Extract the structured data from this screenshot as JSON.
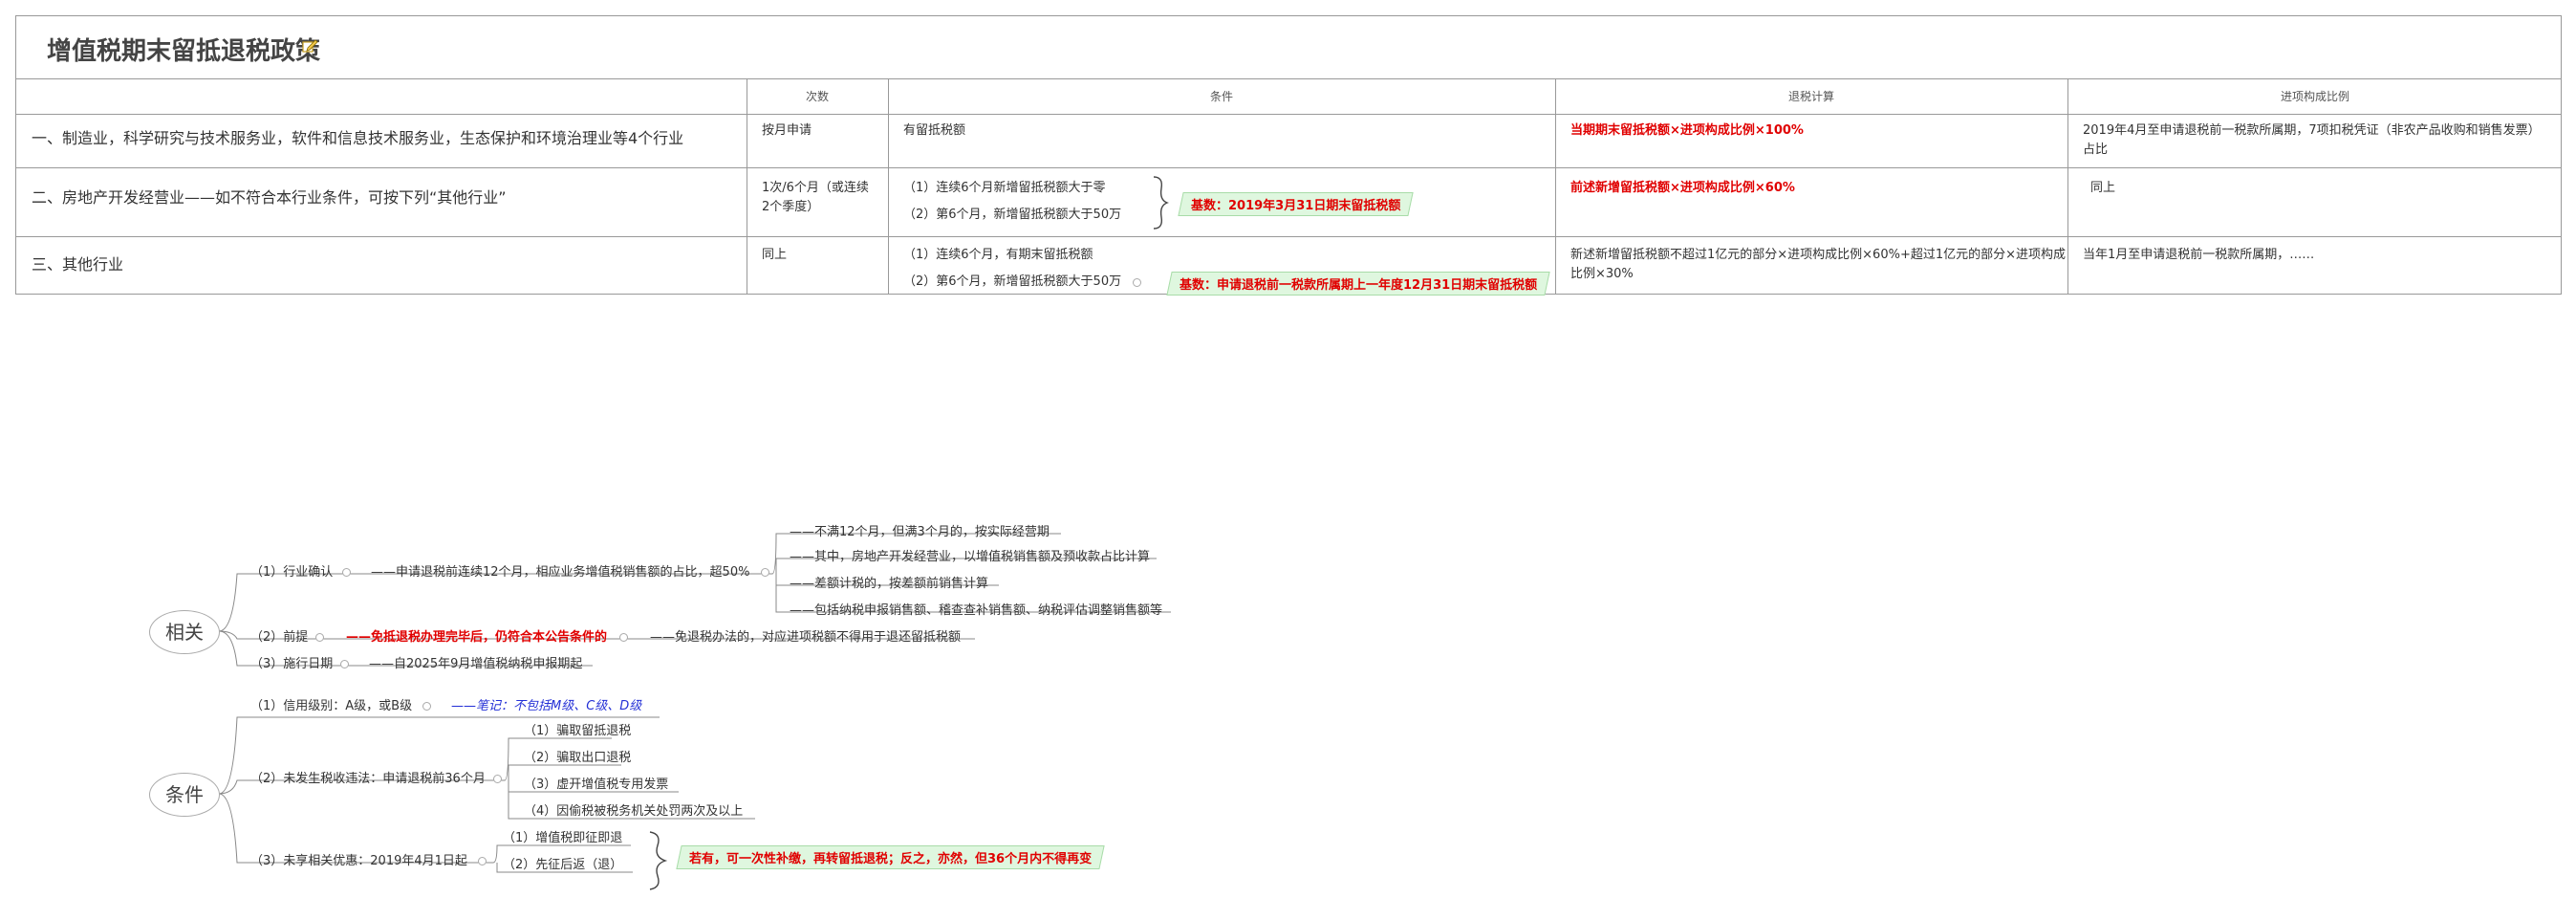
{
  "title": "增值税期末留抵退税政策",
  "table": {
    "headers": [
      "次数",
      "条件",
      "退税计算",
      "进项构成比例"
    ],
    "rows": [
      {
        "industry": "一、制造业，科学研究与技术服务业，软件和信息技术服务业，生态保护和环境治理业等4个行业",
        "frequency": "按月申请",
        "conditions": [
          "有留抵税额"
        ],
        "calc": "当期期末留抵税额×进项构成比例×100%",
        "ratio": "2019年4月至申请退税前一税款所属期，7项扣税凭证（非农产品收购和销售发票）占比"
      },
      {
        "industry": "二、房地产开发经营业——如不符合本行业条件，可按下列“其他行业”",
        "frequency": "1次/6个月（或连续2个季度）",
        "conditions": [
          "（1）连续6个月新增留抵税额大于零",
          "（2）第6个月，新增留抵税额大于50万"
        ],
        "base_note": "基数：2019年3月31日期末留抵税额",
        "calc": "前述新增留抵税额×进项构成比例×60%",
        "ratio": "同上"
      },
      {
        "industry": "三、其他行业",
        "frequency": "同上",
        "conditions": [
          "（1）连续6个月，有期末留抵税额",
          "（2）第6个月，新增留抵税额大于50万"
        ],
        "base_note": "基数：申请退税前一税款所属期上一年度12月31日期末留抵税额",
        "calc": "新述新增留抵税额不超过1亿元的部分×进项构成比例×60%+超过1亿元的部分×进项构成比例×30%",
        "ratio": "当年1月至申请退税前一税款所属期，……"
      }
    ]
  },
  "mindmap": {
    "related": {
      "root": "相关",
      "industry_confirm": "（1）行业确认",
      "industry_confirm_note": "——申请退税前连续12个月，相应业务增值税销售额的占比，超50%",
      "industry_sub": [
        "——不满12个月，但满3个月的，按实际经营期",
        "——其中，房地产开发经营业，以增值税销售额及预收款占比计算",
        "——差额计税的，按差额前销售计算",
        "——包括纳税申报销售额、稽查查补销售额、纳税评估调整销售额等"
      ],
      "premise": "（2）前提",
      "premise_note": "——免抵退税办理完毕后，仍符合本公告条件的",
      "premise_sub": "——免退税办法的，对应进项税额不得用于退还留抵税额",
      "effective": "（3）施行日期",
      "effective_note": "——自2025年9月增值税纳税申报期起"
    },
    "conditions": {
      "root": "条件",
      "credit": "（1）信用级别：A级，或B级",
      "credit_note": "——笔记：不包括M级、C级、D级",
      "no_violation": "（2）未发生税收违法：申请退税前36个月",
      "violations": [
        "（1）骗取留抵退税",
        "（2）骗取出口退税",
        "（3）虚开增值税专用发票",
        "（4）因偷税被税务机关处罚两次及以上"
      ],
      "no_benefit": "（3）未享相关优惠：2019年4月1日起",
      "benefits": [
        "（1）增值税即征即退",
        "（2）先征后返（退）"
      ],
      "benefit_note": "若有，可一次性补缴，再转留抵退税；反之，亦然，但36个月内不得再变"
    }
  },
  "colors": {
    "accent_red": "#e00000",
    "note_blue": "#2430d6",
    "tag_green": "#dff7df"
  }
}
